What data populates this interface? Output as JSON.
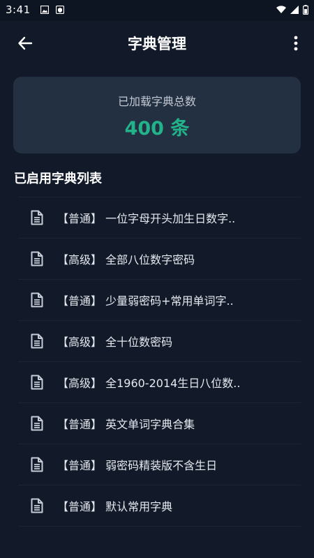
{
  "status_bar": {
    "time": "3:41"
  },
  "header": {
    "title": "字典管理"
  },
  "summary": {
    "label": "已加载字典总数",
    "value": "400 条"
  },
  "section": {
    "title": "已启用字典列表"
  },
  "dictionaries": [
    {
      "text": "【普通】 一位字母开头加生日数字.."
    },
    {
      "text": "【高级】 全部八位数字密码"
    },
    {
      "text": "【普通】 少量弱密码+常用单词字.."
    },
    {
      "text": "【高级】 全十位数密码"
    },
    {
      "text": "【高级】 全1960-2014生日八位数.."
    },
    {
      "text": "【普通】 英文单词字典合集"
    },
    {
      "text": "【普通】 弱密码精装版不含生日"
    },
    {
      "text": "【普通】 默认常用字典"
    }
  ],
  "colors": {
    "background": "#121a2a",
    "card": "#233041",
    "accent": "#22b38a"
  },
  "icons": {
    "back": "arrow-left-icon",
    "more": "more-vertical-icon",
    "document": "document-icon"
  }
}
